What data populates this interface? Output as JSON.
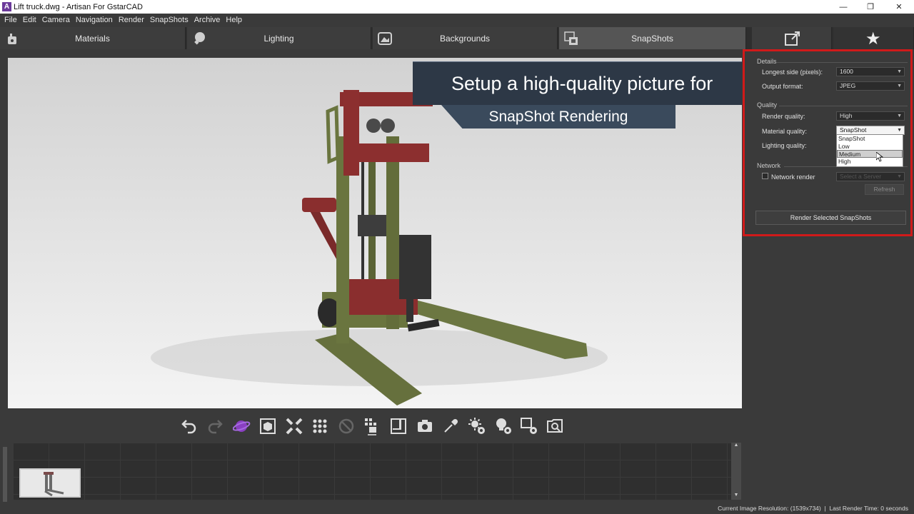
{
  "window": {
    "title": "Lift truck.dwg - Artisan For GstarCAD",
    "app_icon_letter": "A"
  },
  "menu": [
    "File",
    "Edit",
    "Camera",
    "Navigation",
    "Render",
    "SnapShots",
    "Archive",
    "Help"
  ],
  "tabs": [
    {
      "label": "Materials",
      "icon": "materials-icon"
    },
    {
      "label": "Lighting",
      "icon": "bulb-icon"
    },
    {
      "label": "Backgrounds",
      "icon": "background-icon"
    },
    {
      "label": "SnapShots",
      "icon": "snapshots-icon"
    }
  ],
  "tab_extra_icons": [
    "export-icon",
    "star-icon"
  ],
  "banner": {
    "line1": "Setup a high-quality picture for",
    "line2": "SnapShot Rendering"
  },
  "panel": {
    "details_heading": "Details",
    "longest_side_label": "Longest side (pixels):",
    "longest_side_value": "1600",
    "output_format_label": "Output format:",
    "output_format_value": "JPEG",
    "quality_heading": "Quality",
    "render_quality_label": "Render quality:",
    "render_quality_value": "High",
    "material_quality_label": "Material quality:",
    "material_quality_value": "SnapShot",
    "lighting_quality_label": "Lighting quality:",
    "dropdown_options": [
      "SnapShot",
      "Low",
      "Medium",
      "High"
    ],
    "dropdown_highlighted": "Medium",
    "network_heading": "Network",
    "network_render_label": "Network render",
    "network_server_placeholder": "Select a Server",
    "refresh_label": "Refresh",
    "render_button_label": "Render Selected SnapShots"
  },
  "toolbar_icons": [
    "undo-icon",
    "redo-icon",
    "orbit-icon",
    "cube-view-icon",
    "fit-icon",
    "grid-icon",
    "disabled-icon",
    "add-snapshot-icon",
    "frame-icon",
    "camera-icon",
    "eyedropper-icon",
    "sun-settings-icon",
    "light-settings-icon",
    "render-settings-icon",
    "zoom-view-icon"
  ],
  "status": {
    "resolution": "Current Image Resolution: (1539x734)",
    "separator": "|",
    "last_render": "Last Render Time: 0 seconds"
  },
  "colors": {
    "highlight_border": "#d01a1a",
    "banner_bg": "#2d3846",
    "app_bg": "#3a3a3a"
  }
}
